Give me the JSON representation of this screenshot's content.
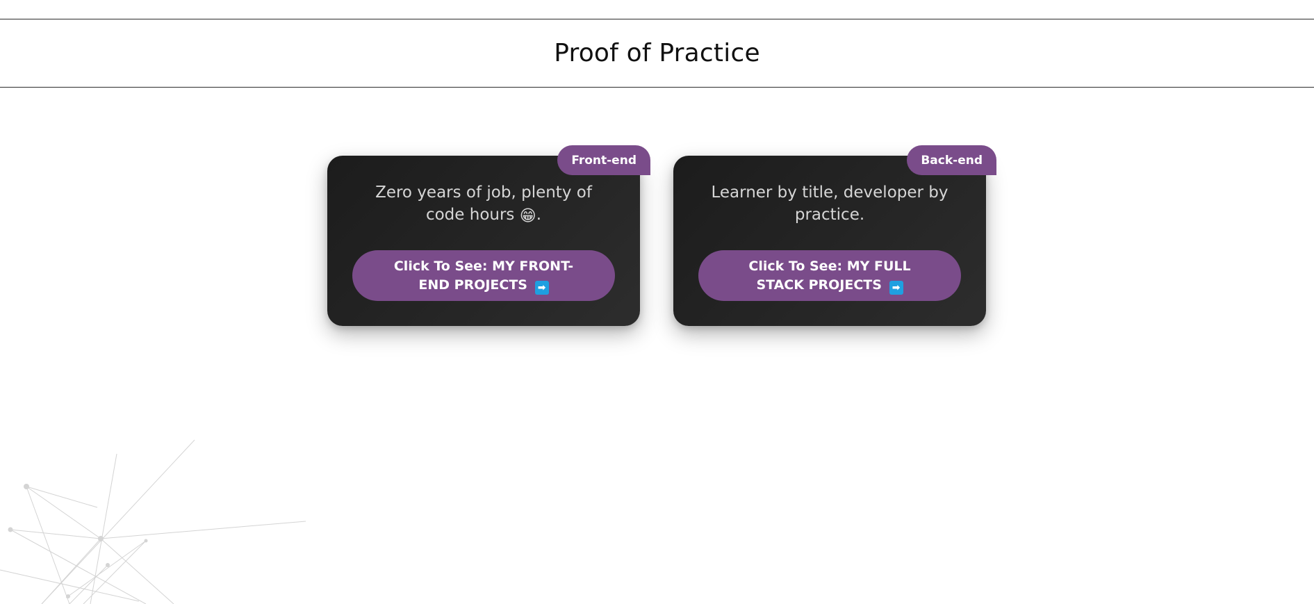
{
  "header": {
    "title": "Proof of Practice"
  },
  "cards": [
    {
      "badge": "Front-end",
      "text_before": "Zero years of job, plenty of code hours",
      "emoji": "😁",
      "text_after": ".",
      "button_prefix": "Click To See:",
      "button_label": "MY FRONT-END PROJECTS",
      "button_icon": "➡"
    },
    {
      "badge": "Back-end",
      "text": "Learner by title, developer by practice.",
      "button_prefix": "Click To See:",
      "button_label": "MY FULL STACK PROJECTS",
      "button_icon": "➡"
    }
  ],
  "colors": {
    "accent": "#7a4c8a",
    "card_bg": "#232323",
    "card_text": "#d6d6d6",
    "arrow_icon_bg": "#1f9fe0"
  },
  "icons": {
    "card_emoji": "grinning-face-icon",
    "button_arrow": "right-arrow-icon",
    "background": "network-lines-decoration"
  }
}
